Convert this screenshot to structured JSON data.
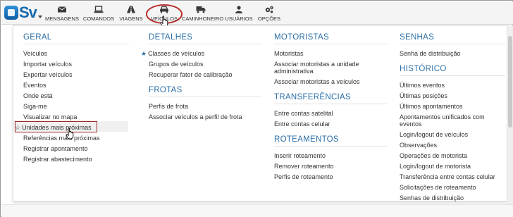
{
  "logo": {
    "text": "Sv"
  },
  "nav": {
    "items": [
      {
        "label": "MENSAGENS",
        "icon": "envelope-icon"
      },
      {
        "label": "COMANDOS",
        "icon": "laptop-icon"
      },
      {
        "label": "VIAGENS",
        "icon": "road-icon"
      },
      {
        "label": "VEÍCULOS",
        "icon": "car-icon"
      },
      {
        "label": "CAMINHONEIRO",
        "icon": "truck-icon"
      },
      {
        "label": "USUÁRIOS",
        "icon": "user-icon"
      },
      {
        "label": "OPÇÕES",
        "icon": "gears-icon"
      }
    ],
    "active": "VEÍCULOS"
  },
  "menu": {
    "geral": {
      "title": "GERAL",
      "items": [
        "Veículos",
        "Importar veículos",
        "Exportar veículos",
        "Eventos",
        "Onde está",
        "Siga-me",
        "Visualizar no mapa",
        "Unidades mais próximas",
        "Referências mais próximas",
        "Registrar apontamento",
        "Registrar abastecimento"
      ]
    },
    "detalhes": {
      "title": "DETALHES",
      "items": [
        "Classes de veículos",
        "Grupos de veículos",
        "Recuperar fator de calibração"
      ]
    },
    "frotas": {
      "title": "FROTAS",
      "items": [
        "Perfis de frota",
        "Associar veículos a perfil de frota"
      ]
    },
    "motoristas": {
      "title": "MOTORISTAS",
      "items": [
        "Motoristas",
        "Associar motoristas a unidade administrativa",
        "Associar motoristas a veículos"
      ]
    },
    "transferencias": {
      "title": "TRANSFERÊNCIAS",
      "items": [
        "Entre contas satelital",
        "Entre contas celular"
      ]
    },
    "roteamentos": {
      "title": "ROTEAMENTOS",
      "items": [
        "Inserir roteamento",
        "Remover roteamento",
        "Perfis de roteamento"
      ]
    },
    "senhas": {
      "title": "SENHAS",
      "items": [
        "Senha de distribuição"
      ]
    },
    "historico": {
      "title": "HISTÓRICO",
      "items": [
        "Últimos eventos",
        "Últimas posições",
        "Últimos apontamentos",
        "Apontamentos unificados com eventos",
        "Login/logout de veículos",
        "Observações",
        "Operações de motorista",
        "Login/logout de motorista",
        "Transferência entre contas celular",
        "Solicitações de roteamento",
        "Senhas de distribuição"
      ]
    }
  }
}
